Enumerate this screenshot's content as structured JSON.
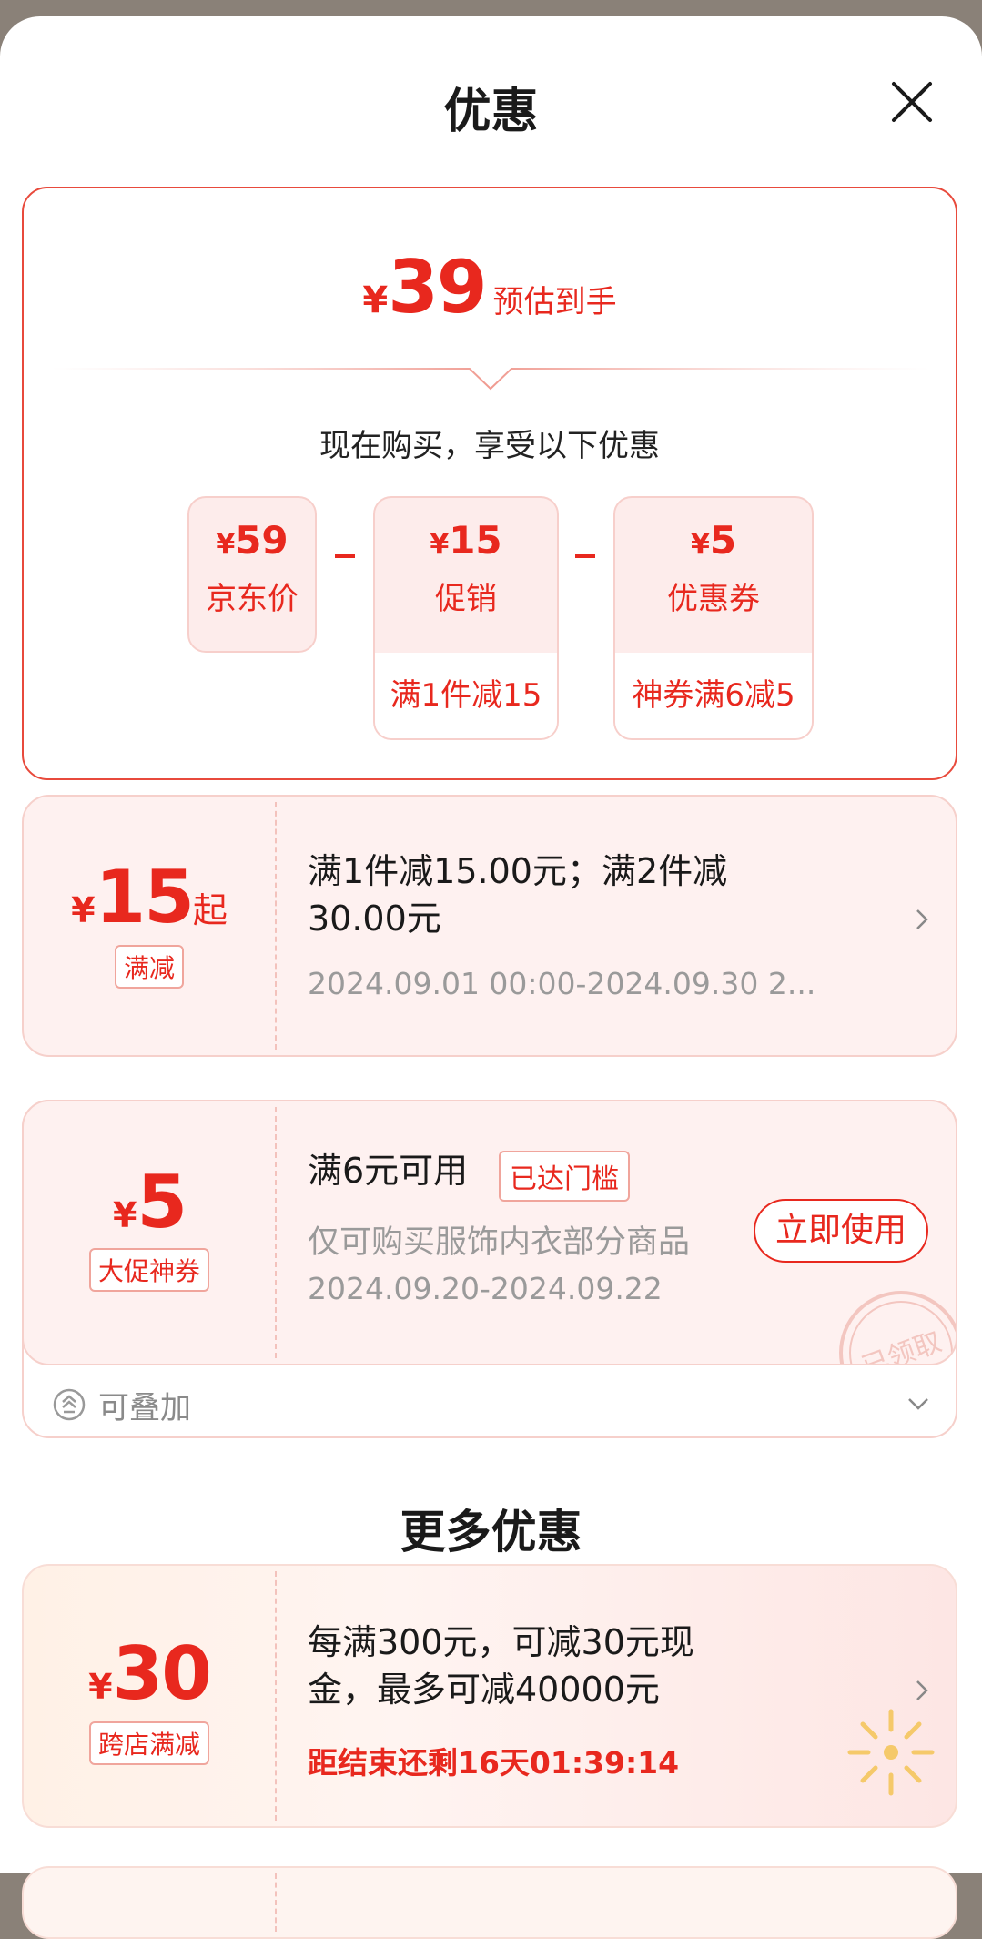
{
  "header": {
    "title": "优惠"
  },
  "summary": {
    "currency": "¥",
    "final_price": "39",
    "final_label": "预估到手",
    "intro": "现在购买，享受以下优惠",
    "components": [
      {
        "amount": "59",
        "name": "京东价"
      },
      {
        "amount": "15",
        "name": "促销",
        "rule": "满1件减15"
      },
      {
        "amount": "5",
        "name": "优惠券",
        "rule": "神券满6减5"
      }
    ],
    "operator": "-"
  },
  "promo": {
    "currency": "¥",
    "amount": "15",
    "suffix": "起",
    "tag": "满减",
    "desc_line1": "满1件减15.00元；满2件减",
    "desc_line2": "30.00元",
    "period": "2024.09.01 00:00-2024.09.30 2..."
  },
  "coupon": {
    "currency": "¥",
    "amount": "5",
    "tag": "大促神券",
    "condition": "满6元可用",
    "status": "已达门槛",
    "scope": "仅可购买服饰内衣部分商品",
    "period": "2024.09.20-2024.09.22",
    "button": "立即使用",
    "stamp": "已领取",
    "stackable": "可叠加"
  },
  "more": {
    "title": "更多优惠",
    "items": [
      {
        "currency": "¥",
        "amount": "30",
        "tag": "跨店满减",
        "desc_line1": "每满300元，可减30元现",
        "desc_line2": "金，最多可减40000元",
        "countdown": "距结束还剩16天01:39:14"
      }
    ]
  },
  "colors": {
    "accent": "#e8281e",
    "card_bg": "#fef1f0",
    "border": "#f6d0cb"
  }
}
